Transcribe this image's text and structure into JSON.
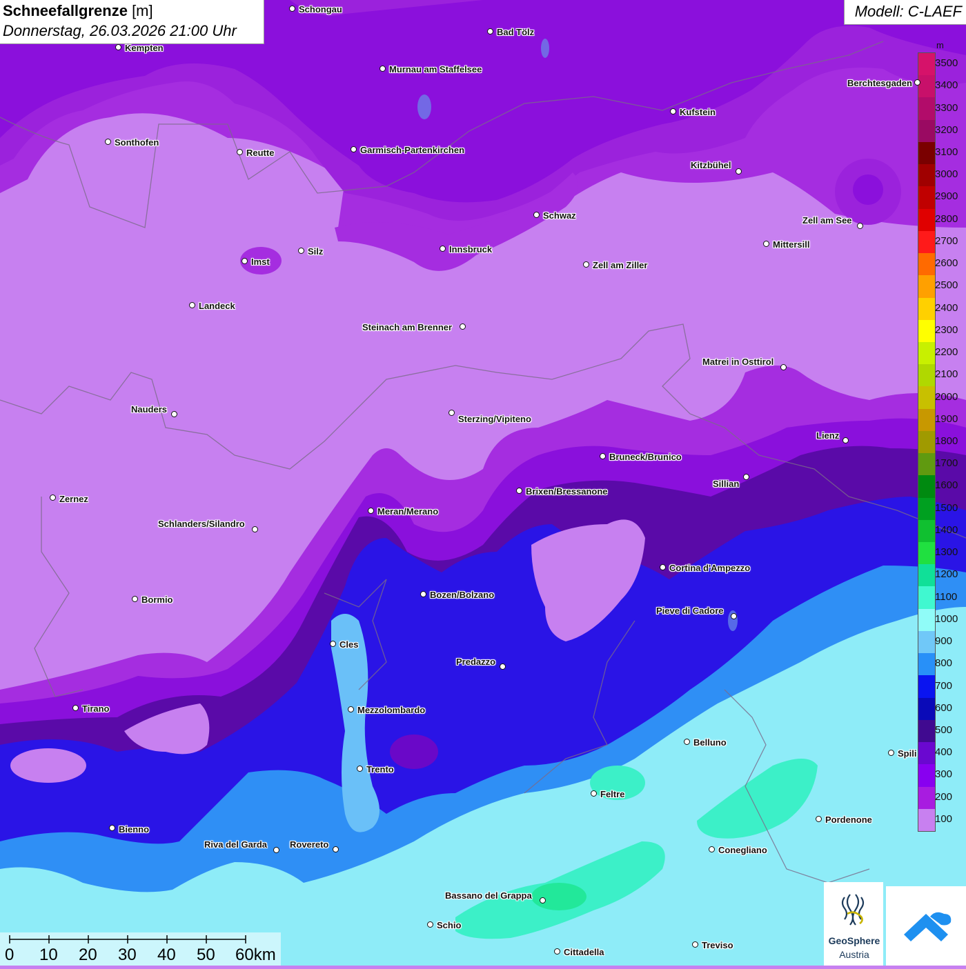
{
  "header": {
    "title_bold": "Schneefallgrenze",
    "title_unit": " [m]",
    "datetime": "Donnerstag, 26.03.2026 21:00 Uhr",
    "model": "Modell: C-LAEF"
  },
  "legend": {
    "unit": "m",
    "levels": [
      {
        "label": "3500",
        "color": "#d6126a"
      },
      {
        "label": "3400",
        "color": "#c8106a"
      },
      {
        "label": "3300",
        "color": "#b20c6a"
      },
      {
        "label": "3200",
        "color": "#9a0a62"
      },
      {
        "label": "3100",
        "color": "#7a0000"
      },
      {
        "label": "3000",
        "color": "#a00000"
      },
      {
        "label": "2900",
        "color": "#c00000"
      },
      {
        "label": "2800",
        "color": "#e00000"
      },
      {
        "label": "2700",
        "color": "#ff1a1a"
      },
      {
        "label": "2600",
        "color": "#ff6a00"
      },
      {
        "label": "2500",
        "color": "#ffa000"
      },
      {
        "label": "2400",
        "color": "#ffd000"
      },
      {
        "label": "2300",
        "color": "#ffff00"
      },
      {
        "label": "2200",
        "color": "#c8f000"
      },
      {
        "label": "2100",
        "color": "#b0d800"
      },
      {
        "label": "2000",
        "color": "#c8c000"
      },
      {
        "label": "1900",
        "color": "#c89800"
      },
      {
        "label": "1800",
        "color": "#a09a00"
      },
      {
        "label": "1700",
        "color": "#609a10"
      },
      {
        "label": "1600",
        "color": "#008a10"
      },
      {
        "label": "1500",
        "color": "#00a020"
      },
      {
        "label": "1400",
        "color": "#10c030"
      },
      {
        "label": "1300",
        "color": "#20e040"
      },
      {
        "label": "1200",
        "color": "#10e098"
      },
      {
        "label": "1100",
        "color": "#40f8d0"
      },
      {
        "label": "1000",
        "color": "#90fcf8"
      },
      {
        "label": "900",
        "color": "#70c8f8"
      },
      {
        "label": "800",
        "color": "#2890f8"
      },
      {
        "label": "700",
        "color": "#0a14f0"
      },
      {
        "label": "600",
        "color": "#0a0ab8"
      },
      {
        "label": "500",
        "color": "#400a90"
      },
      {
        "label": "400",
        "color": "#6a08d0"
      },
      {
        "label": "300",
        "color": "#8800f0"
      },
      {
        "label": "200",
        "color": "#a81ce0"
      },
      {
        "label": "100",
        "color": "#c880f0"
      }
    ]
  },
  "cities": [
    {
      "name": "Schongau"
    },
    {
      "name": "Bad Tölz"
    },
    {
      "name": "Kempten"
    },
    {
      "name": "Murnau am Staffelsee"
    },
    {
      "name": "Berchtesgaden"
    },
    {
      "name": "Kufstein"
    },
    {
      "name": "Sonthofen"
    },
    {
      "name": "Reutte"
    },
    {
      "name": "Garmisch-Partenkirchen"
    },
    {
      "name": "Kitzbühel"
    },
    {
      "name": "Schwaz"
    },
    {
      "name": "Zell am See"
    },
    {
      "name": "Innsbruck"
    },
    {
      "name": "Mittersill"
    },
    {
      "name": "Imst"
    },
    {
      "name": "Silz"
    },
    {
      "name": "Zell am Ziller"
    },
    {
      "name": "Landeck"
    },
    {
      "name": "Steinach am Brenner"
    },
    {
      "name": "Matrei in Osttirol"
    },
    {
      "name": "Nauders"
    },
    {
      "name": "Sterzing/Vipiteno"
    },
    {
      "name": "Lienz"
    },
    {
      "name": "Bruneck/Brunico"
    },
    {
      "name": "Sillian"
    },
    {
      "name": "Brixen/Bressanone"
    },
    {
      "name": "Zernez"
    },
    {
      "name": "Meran/Merano"
    },
    {
      "name": "Schlanders/Silandro"
    },
    {
      "name": "Cortina d'Ampezzo"
    },
    {
      "name": "Bozen/Bolzano"
    },
    {
      "name": "Bormio"
    },
    {
      "name": "Pieve di Cadore"
    },
    {
      "name": "Cles"
    },
    {
      "name": "Predazzo"
    },
    {
      "name": "Tirano"
    },
    {
      "name": "Mezzolombardo"
    },
    {
      "name": "Belluno"
    },
    {
      "name": "Spili"
    },
    {
      "name": "Trento"
    },
    {
      "name": "Feltre"
    },
    {
      "name": "Pordenone"
    },
    {
      "name": "Bienno"
    },
    {
      "name": "Riva del Garda"
    },
    {
      "name": "Rovereto"
    },
    {
      "name": "Conegliano"
    },
    {
      "name": "Bassano del Grappa"
    },
    {
      "name": "Schio"
    },
    {
      "name": "Treviso"
    },
    {
      "name": "Cittadella"
    }
  ],
  "scale_bar": {
    "labels": [
      "0",
      "10",
      "20",
      "30",
      "40",
      "50",
      "60km"
    ]
  },
  "logo": {
    "name": "GeoSphere",
    "sub": "Austria"
  }
}
